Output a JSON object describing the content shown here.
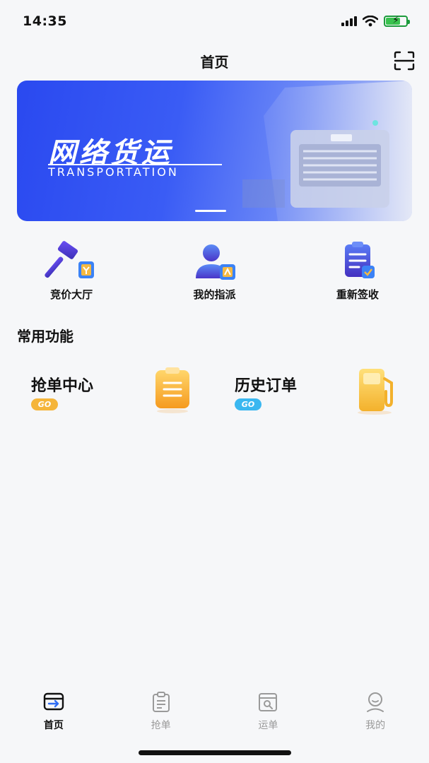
{
  "status_bar": {
    "time": "14:35"
  },
  "header": {
    "title": "首页",
    "scan_icon": "scan-icon"
  },
  "banner": {
    "title": "网络货运",
    "subtitle": "TRANSPORTATION",
    "brand_color": "#2a49f0"
  },
  "quick_actions": [
    {
      "label": "竞价大厅",
      "icon": "auction-hammer-icon"
    },
    {
      "label": "我的指派",
      "icon": "assign-user-icon"
    },
    {
      "label": "重新签收",
      "icon": "re-sign-clipboard-icon"
    }
  ],
  "common_section": {
    "title": "常用功能",
    "items": [
      {
        "label": "抢单中心",
        "badge": "GO",
        "badge_color": "#f5b53a",
        "icon": "clipboard-icon"
      },
      {
        "label": "历史订单",
        "badge": "GO",
        "badge_color": "#3ab7f0",
        "icon": "fuel-pump-icon"
      }
    ]
  },
  "tab_bar": {
    "active_color": "#111111",
    "inactive_color": "#9a9a9a",
    "items": [
      {
        "label": "首页",
        "icon": "home-icon",
        "active": true
      },
      {
        "label": "抢单",
        "icon": "grab-order-icon",
        "active": false
      },
      {
        "label": "运单",
        "icon": "waybill-icon",
        "active": false
      },
      {
        "label": "我的",
        "icon": "profile-icon",
        "active": false
      }
    ]
  }
}
